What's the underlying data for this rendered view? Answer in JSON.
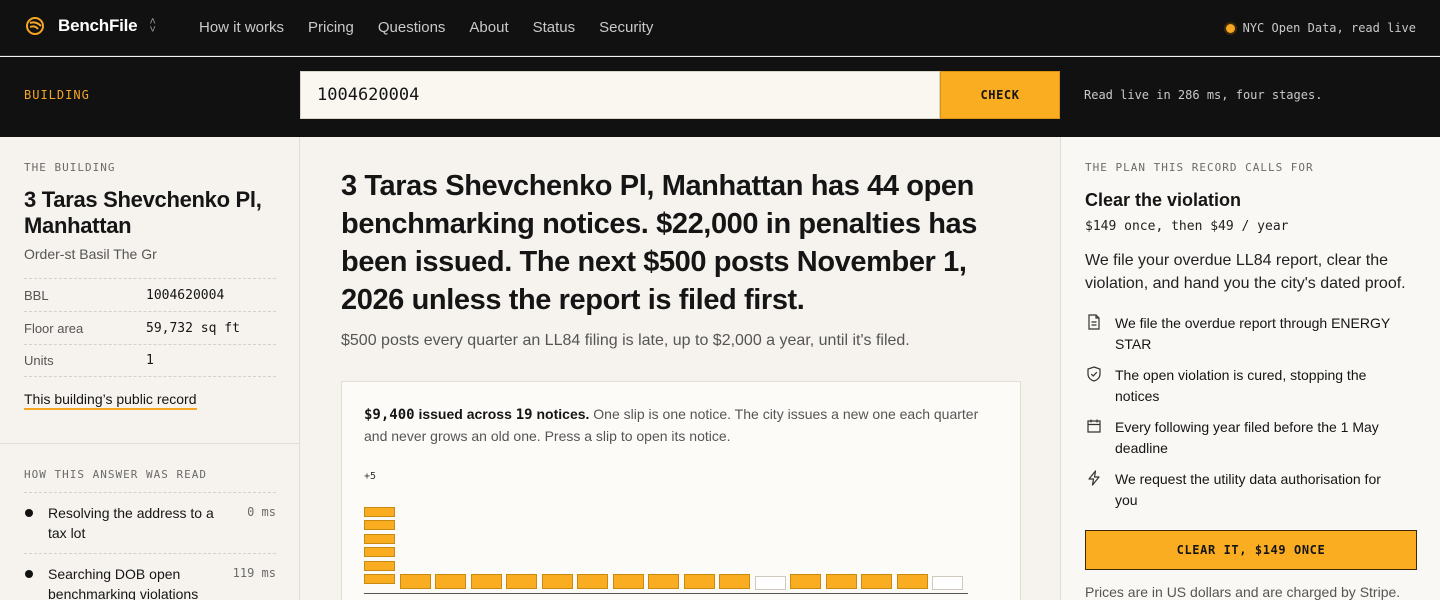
{
  "nav": {
    "brand": "BenchFile",
    "links": [
      "How it works",
      "Pricing",
      "Questions",
      "About",
      "Status",
      "Security"
    ],
    "live_status": "NYC Open Data, read live"
  },
  "search": {
    "label": "BUILDING",
    "value": "1004620004",
    "button": "CHECK",
    "note": "Read live in 286 ms, four stages."
  },
  "building": {
    "eyebrow": "THE BUILDING",
    "name": "3 Taras Shevchenko Pl, Manhattan",
    "subtitle": "Order-st Basil The Gr",
    "facts": [
      {
        "label": "BBL",
        "value": "1004620004"
      },
      {
        "label": "Floor area",
        "value": "59,732 sq ft"
      },
      {
        "label": "Units",
        "value": "1"
      }
    ],
    "record_link": "This building’s public record"
  },
  "how": {
    "eyebrow": "HOW THIS ANSWER WAS READ",
    "steps": [
      {
        "text": "Resolving the address to a tax lot",
        "ms": "0 ms"
      },
      {
        "text": "Searching DOB open benchmarking violations",
        "ms": "119 ms"
      }
    ]
  },
  "summary": {
    "headline": "3 Taras Shevchenko Pl, Manhattan has 44 open benchmarking notices. $22,000 in penalties has been issued. The next $500 posts November 1, 2026 unless the report is filed first.",
    "subline": "$500 posts every quarter an LL84 filing is late, up to $2,000 a year, until it's filed."
  },
  "slips": {
    "issued_amount": "$9,400",
    "issued_label": "issued across",
    "notice_count": "19",
    "notice_label": "notices.",
    "description": "One slip is one notice. The city issues a new one each quarter and never grows an old one. Press a slip to open its notice.",
    "overflow_label": "+5",
    "columns": [
      6,
      1,
      1,
      1,
      1,
      1,
      1,
      1,
      1,
      1,
      1,
      0,
      1,
      1,
      1,
      1,
      0
    ]
  },
  "plan": {
    "eyebrow": "THE PLAN THIS RECORD CALLS FOR",
    "title": "Clear the violation",
    "price": "$149 once, then $49 / year",
    "description": "We file your overdue LL84 report, clear the violation, and hand you the city's dated proof.",
    "features": [
      {
        "icon": "document-icon",
        "text": "We file the overdue report through ENERGY STAR"
      },
      {
        "icon": "shield-check-icon",
        "text": "The open violation is cured, stopping the notices"
      },
      {
        "icon": "calendar-icon",
        "text": "Every following year filed before the 1 May deadline"
      },
      {
        "icon": "lightning-icon",
        "text": "We request the utility data authorisation for you"
      }
    ],
    "cta": "CLEAR IT, $149 ONCE",
    "note": "Prices are in US dollars and are charged by Stripe."
  },
  "colors": {
    "accent": "#fbad21",
    "dark": "#111111",
    "paper": "#f6f3ee"
  }
}
